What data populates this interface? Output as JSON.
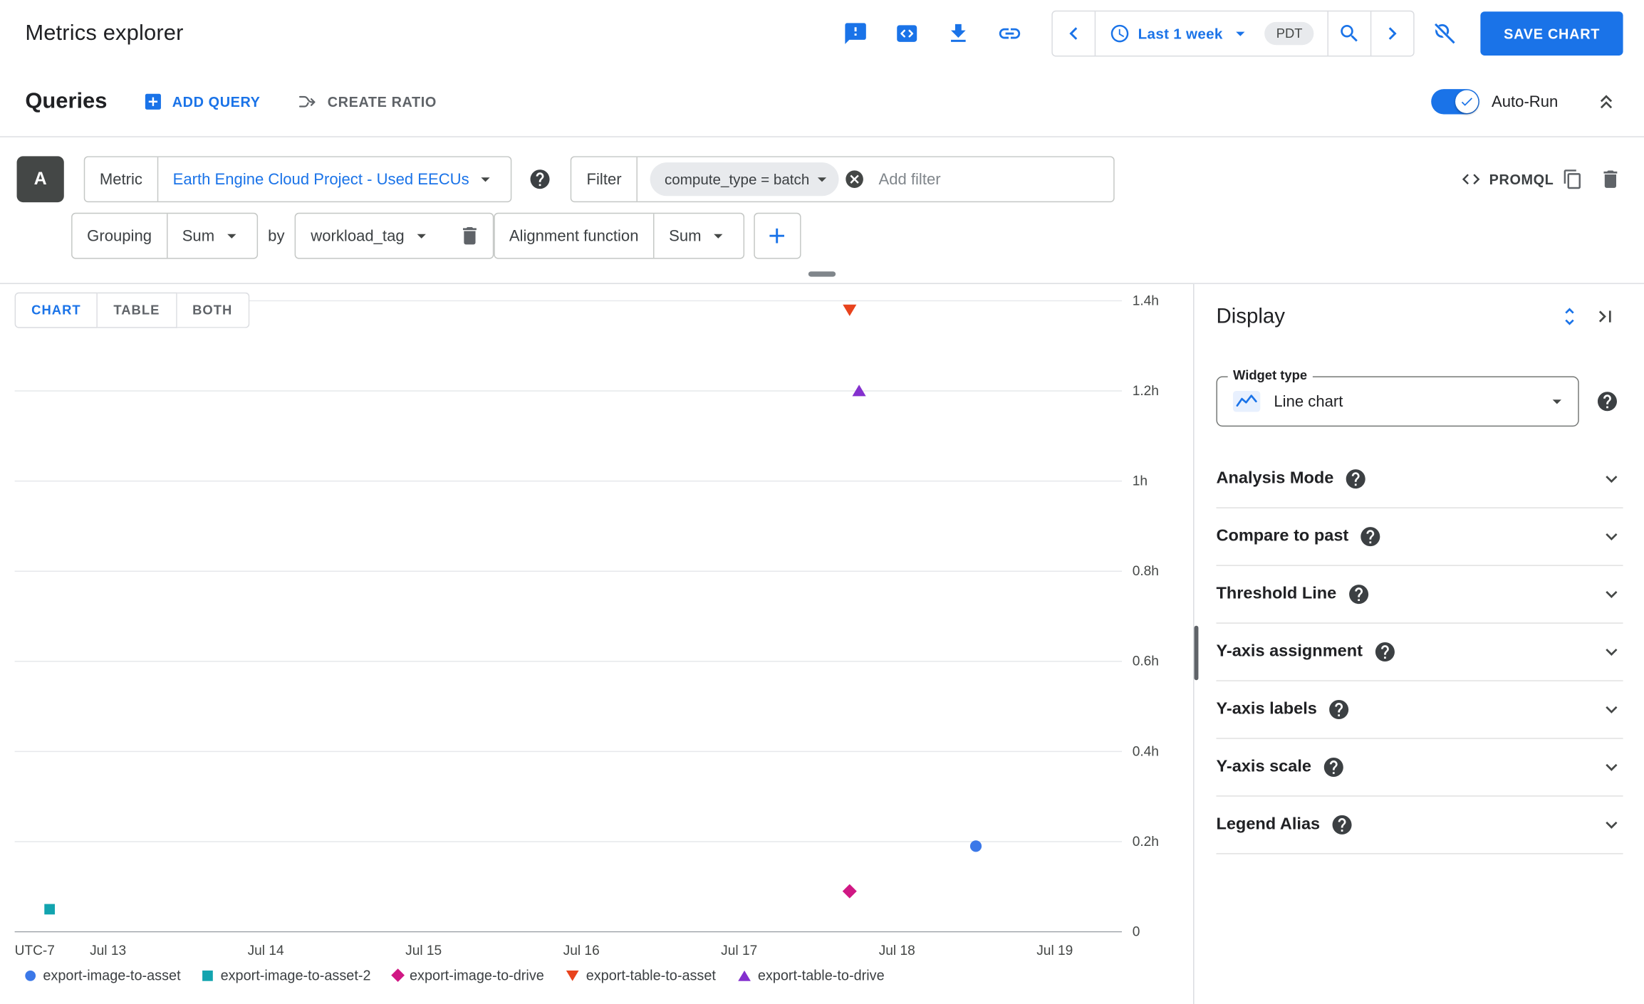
{
  "header": {
    "title": "Metrics explorer",
    "time_range": {
      "label": "Last 1 week",
      "timezone": "PDT"
    },
    "save_button": "SAVE CHART"
  },
  "queries_bar": {
    "title": "Queries",
    "add_query": "ADD QUERY",
    "create_ratio": "CREATE RATIO",
    "auto_run": "Auto-Run",
    "auto_run_enabled": true
  },
  "query": {
    "letter": "A",
    "metric_label": "Metric",
    "metric_value": "Earth Engine Cloud Project - Used EECUs",
    "filter_label": "Filter",
    "filter_chip": "compute_type = batch",
    "add_filter_placeholder": "Add filter",
    "promql": "PROMQL",
    "grouping_label": "Grouping",
    "grouping_value": "Sum",
    "by_label": "by",
    "group_by_value": "workload_tag",
    "alignment_label": "Alignment function",
    "alignment_value": "Sum"
  },
  "chart_tabs": {
    "labels": [
      "CHART",
      "TABLE",
      "BOTH"
    ],
    "selected": "CHART"
  },
  "chart_data": {
    "type": "scatter",
    "title": "",
    "xlabel": "",
    "ylabel": "",
    "grid": "horizontal",
    "legend_position": "bottom",
    "x_axis": {
      "timezone_label": "UTC-7",
      "ticks": [
        {
          "day": 0,
          "label": "Jul 13"
        },
        {
          "day": 1,
          "label": "Jul 14"
        },
        {
          "day": 2,
          "label": "Jul 15"
        },
        {
          "day": 3,
          "label": "Jul 16"
        },
        {
          "day": 4,
          "label": "Jul 17"
        },
        {
          "day": 5,
          "label": "Jul 18"
        },
        {
          "day": 6,
          "label": "Jul 19"
        }
      ]
    },
    "y_axis": {
      "unit": "hours",
      "range": [
        0,
        1.4
      ],
      "ticks": [
        {
          "value": 0,
          "label": "0"
        },
        {
          "value": 0.2,
          "label": "0.2h"
        },
        {
          "value": 0.4,
          "label": "0.4h"
        },
        {
          "value": 0.6,
          "label": "0.6h"
        },
        {
          "value": 0.8,
          "label": "0.8h"
        },
        {
          "value": 1,
          "label": "1h"
        },
        {
          "value": 1.2,
          "label": "1.2h"
        },
        {
          "value": 1.4,
          "label": "1.4h"
        }
      ]
    },
    "series": [
      {
        "name": "export-image-to-asset",
        "marker": "circle",
        "color": "#3b78e8",
        "points": [
          {
            "day": 5.5,
            "hours": 0.19
          }
        ]
      },
      {
        "name": "export-image-to-asset-2",
        "marker": "square",
        "color": "#12a4af",
        "points": [
          {
            "day": -0.37,
            "hours": 0.05
          }
        ]
      },
      {
        "name": "export-image-to-drive",
        "marker": "diamond",
        "color": "#d01884",
        "points": [
          {
            "day": 4.7,
            "hours": 0.09
          }
        ]
      },
      {
        "name": "export-table-to-asset",
        "marker": "triangle-down",
        "color": "#e8431d",
        "points": [
          {
            "day": 4.7,
            "hours": 1.38
          }
        ]
      },
      {
        "name": "export-table-to-drive",
        "marker": "triangle-up",
        "color": "#8430ce",
        "points": [
          {
            "day": 4.76,
            "hours": 1.2
          }
        ]
      }
    ]
  },
  "display_panel": {
    "title": "Display",
    "widget_type_label": "Widget type",
    "widget_type_value": "Line chart",
    "sections": [
      "Analysis Mode",
      "Compare to past",
      "Threshold Line",
      "Y-axis assignment",
      "Y-axis labels",
      "Y-axis scale",
      "Legend Alias"
    ]
  },
  "colors": {
    "accent": "#1a73e8",
    "text": "#202124",
    "border": "#dadce0"
  },
  "icons": {
    "feedback": "speech-bubble-exclaim",
    "query-editor": "code-box",
    "download": "arrow-down-tray",
    "share-link": "chain-link",
    "time-back": "chevron-left",
    "clock": "clock-outline",
    "zoom": "magnifier",
    "time-forward": "chevron-right",
    "zoom-disable": "magnifier-slash",
    "add-query": "plus-box",
    "create-ratio": "split-arrow",
    "collapse-queries": "double-chevron-up",
    "help": "question-circle",
    "remove-filter": "x-circle",
    "promql": "code-angle-brackets",
    "duplicate": "copy",
    "delete": "trash",
    "add-step": "plus",
    "expand-sections": "unfold-more",
    "collapse-panel": "arrow-to-right",
    "widget-type": "line-chart",
    "section-expand": "chevron-down",
    "auto-run-check": "checkmark"
  }
}
